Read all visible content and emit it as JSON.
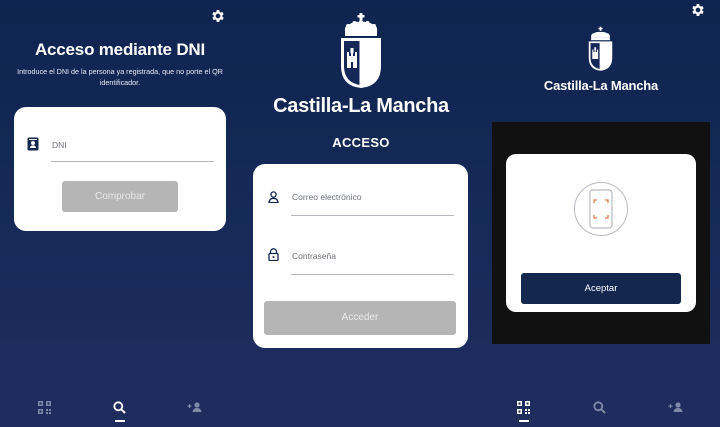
{
  "colors": {
    "background": "#152857",
    "card": "#ffffff",
    "button_disabled": "#b5b5b5",
    "button_primary": "#13274f",
    "qr_frame_accent": "#e07a4a"
  },
  "screen_dni": {
    "title": "Acceso mediante DNI",
    "subtitle": "Introduce el DNI de la persona ya registrada, que no porte el QR identificador.",
    "dni_placeholder": "DNI",
    "check_button": "Comprobar",
    "settings_icon": "gear-icon",
    "active_nav": "search"
  },
  "screen_login": {
    "brand_name": "Castilla-La Mancha",
    "heading": "ACCESO",
    "email_placeholder": "Correo electrónico",
    "password_placeholder": "Contraseña",
    "login_button": "Acceder"
  },
  "screen_scan": {
    "brand_name": "Castilla-La Mancha",
    "accept_button": "Aceptar",
    "settings_icon": "gear-icon",
    "active_nav": "qr"
  },
  "navbar": {
    "items": [
      "qr-icon",
      "search-icon",
      "add-user-icon"
    ]
  }
}
